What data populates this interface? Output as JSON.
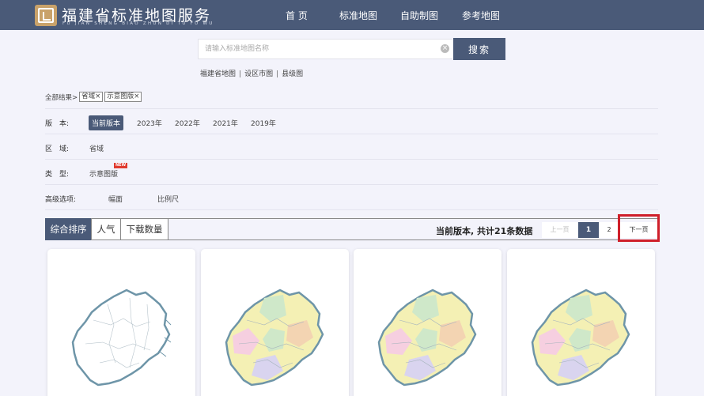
{
  "header": {
    "title": "福建省标准地图服务",
    "subtitle": "FU JIAN SHENG BIAO ZHUN DI TU FU WU",
    "nav": [
      {
        "label": "首 页"
      },
      {
        "label": "标准地图"
      },
      {
        "label": "自助制图"
      },
      {
        "label": "参考地图"
      }
    ]
  },
  "search": {
    "placeholder": "请输入标准地图名称",
    "button_label": "搜索",
    "quick_links": [
      "福建省地图",
      "设区市图",
      "县级图"
    ]
  },
  "filters": {
    "breadcrumb_prefix": "全部结果>",
    "selected_tags": [
      "省域×",
      "示意图版×"
    ],
    "edition": {
      "label": "版　本:",
      "options": [
        "当前版本",
        "2023年",
        "2022年",
        "2021年",
        "2019年"
      ],
      "active": "当前版本"
    },
    "region": {
      "label": "区　域:",
      "options": [
        "省域"
      ]
    },
    "type": {
      "label": "类　型:",
      "options": [
        "示意图版"
      ],
      "badge": "NEW"
    },
    "advanced": {
      "label": "高级选项:",
      "options": [
        "幅面",
        "比例尺"
      ]
    }
  },
  "sort": {
    "tabs": [
      "综合排序",
      "人气",
      "下载数量"
    ],
    "active": "综合排序"
  },
  "results": {
    "summary": "当前版本, 共计21条数据"
  },
  "pagination": {
    "prev_label": "上一页",
    "pages": [
      "1",
      "2"
    ],
    "current": "1",
    "next_label": "下一页"
  },
  "colors": {
    "header_bg": "#4a5a78",
    "accent": "#4a5a78",
    "highlight_border": "#cf1f2a",
    "new_badge": "#e03a2f"
  },
  "cards": [
    {
      "style": "outline"
    },
    {
      "style": "colored"
    },
    {
      "style": "colored"
    },
    {
      "style": "colored"
    }
  ]
}
